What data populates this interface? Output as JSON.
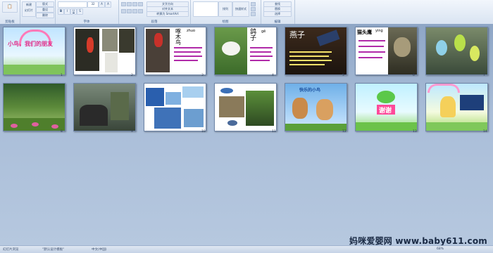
{
  "ribbon": {
    "groups": [
      "剪贴板",
      "字体",
      "段落",
      "绘图",
      "编辑"
    ],
    "new_slide": "新建\n幻灯片",
    "font_size": "32",
    "buttons": [
      "版式",
      "重设",
      "删除",
      "文字方向",
      "对齐文本",
      "转换为 SmartArt",
      "形状",
      "排列",
      "快速样式",
      "查找",
      "替换",
      "选择"
    ]
  },
  "slides": [
    {
      "num": "1",
      "title": "小鸟，我们的朋友"
    },
    {
      "num": "2",
      "title": ""
    },
    {
      "num": "3",
      "title": "啄木鸟",
      "sub": "zhuo"
    },
    {
      "num": "4",
      "title": "鸽子",
      "sub": "gē"
    },
    {
      "num": "5",
      "title": "燕子"
    },
    {
      "num": "6",
      "title": "猫头鹰",
      "sub": "ying"
    },
    {
      "num": "7",
      "title": ""
    },
    {
      "num": "8",
      "title": ""
    },
    {
      "num": "9",
      "title": ""
    },
    {
      "num": "10",
      "title": ""
    },
    {
      "num": "11",
      "title": ""
    },
    {
      "num": "12",
      "title": "快乐的小鸟"
    },
    {
      "num": "13",
      "title": "谢谢"
    },
    {
      "num": "14",
      "title": ""
    }
  ],
  "status": {
    "view": "幻灯片浏览",
    "theme": "\"默认设计模板\"",
    "lang": "中文(中国)",
    "zoom": "68%"
  },
  "watermark": "妈咪爱婴网 www.baby611.com"
}
